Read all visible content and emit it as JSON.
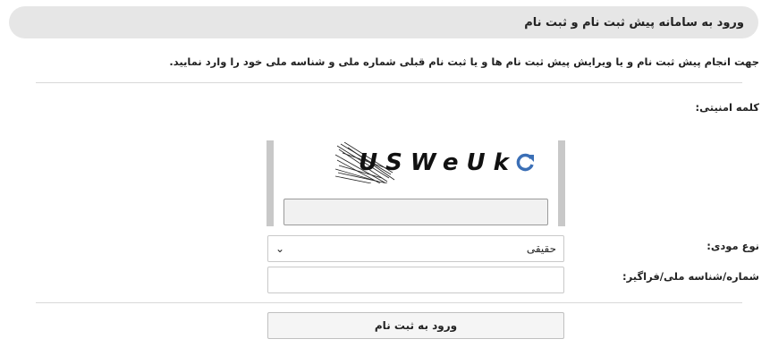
{
  "header": {
    "title": "ورود به سامانه پیش ثبت نام و ثبت نام"
  },
  "intro": {
    "text": "جهت انجام پیش ثبت نام و یا ویرایش پیش ثبت نام ها و یا ثبت نام قبلی شماره ملی و شناسه ملی خود را وارد نمایید."
  },
  "form": {
    "security_label": "کلمه امنیتی:",
    "captcha_text": "USWeUk",
    "captcha_input_value": "",
    "taxpayer_type_label": "نوع مودی:",
    "taxpayer_type_value": "حقیقی",
    "national_id_label": "شماره/شناسه ملی/فراگیر:",
    "national_id_value": "",
    "submit_label": "ورود به ثبت نام"
  },
  "icons": {
    "refresh": "refresh-icon",
    "dropdown": "chevron-down-icon"
  },
  "colors": {
    "header_bg": "#e6e6e6",
    "refresh_icon": "#3b6fb6"
  }
}
